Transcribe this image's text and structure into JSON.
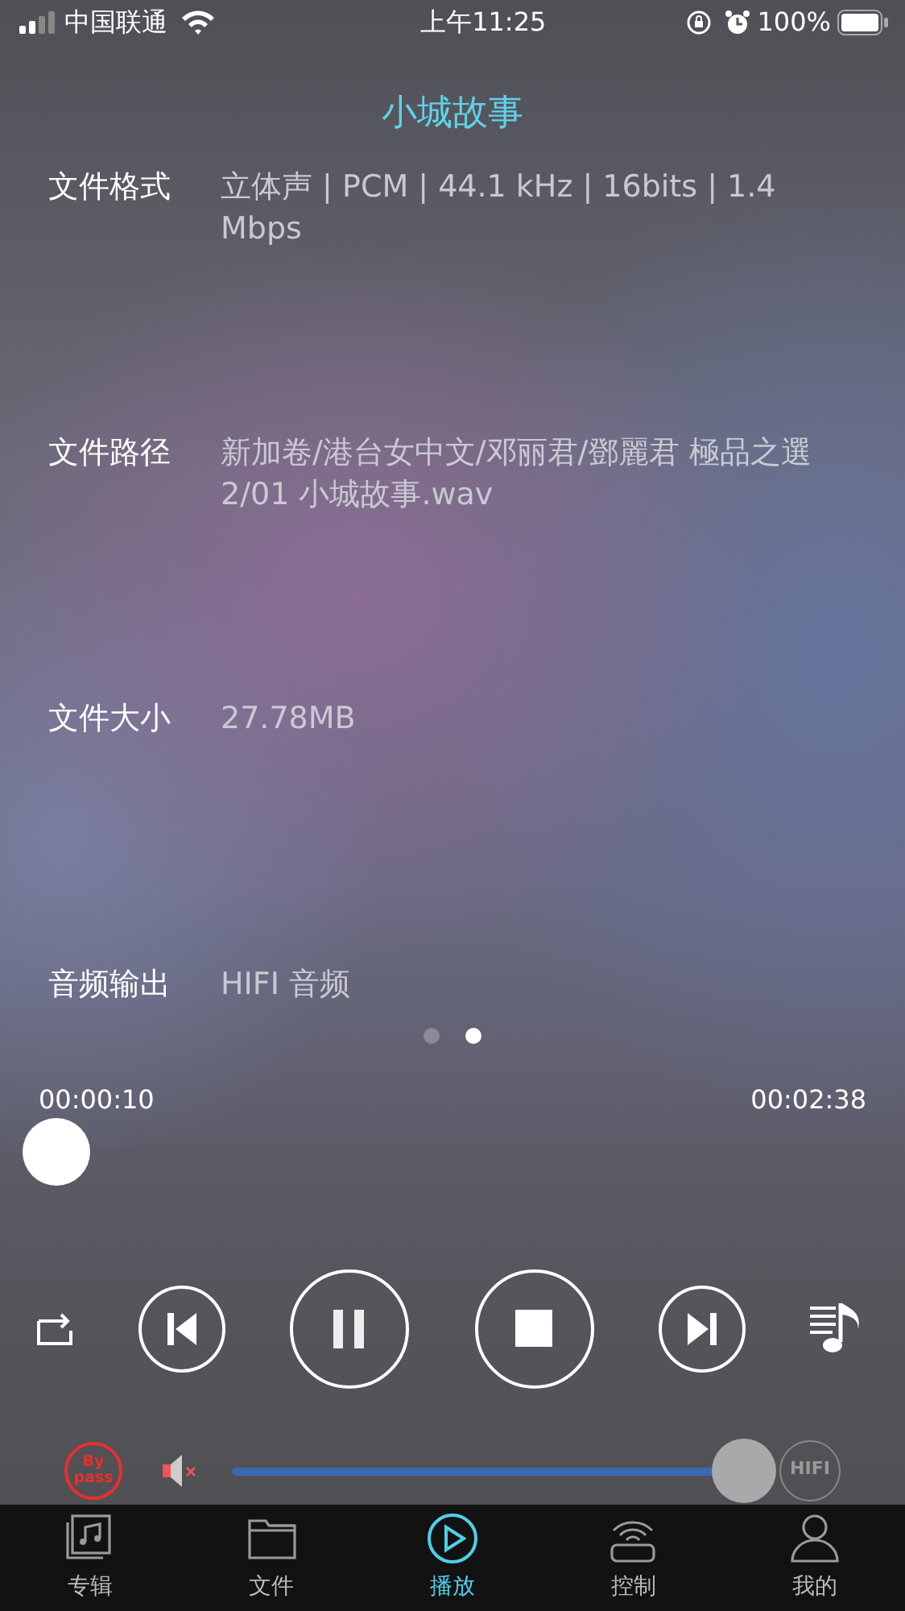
{
  "status_bar": {
    "carrier": "中国联通",
    "time": "上午11:25",
    "battery": "100%"
  },
  "title": "小城故事",
  "info": [
    {
      "label": "文件格式",
      "value": "立体声 | PCM | 44.1 kHz | 16bits | 1.4 Mbps"
    },
    {
      "label": "文件路径",
      "value": "新加卷/港台女中文/邓丽君/鄧麗君  極品之選 2/01 小城故事.wav"
    },
    {
      "label": "文件大小",
      "value": "27.78MB"
    },
    {
      "label": "音频输出",
      "value": "HIFI 音频"
    }
  ],
  "pages": [
    {
      "selected": false
    },
    {
      "selected": true
    }
  ],
  "progress": {
    "elapsed": "00:00:10",
    "total": "00:02:38",
    "level": 0.02
  },
  "bypass": {
    "label": "By pass"
  },
  "volume": {
    "level": 1.0
  },
  "hifi": {
    "label": "HIFI"
  },
  "tabs": [
    {
      "label": "专辑",
      "kind": "album",
      "selected": false
    },
    {
      "label": "文件",
      "kind": "folder",
      "selected": false
    },
    {
      "label": "播放",
      "kind": "play",
      "selected": true
    },
    {
      "label": "控制",
      "kind": "remote",
      "selected": false
    },
    {
      "label": "我的",
      "kind": "person",
      "selected": false
    }
  ]
}
